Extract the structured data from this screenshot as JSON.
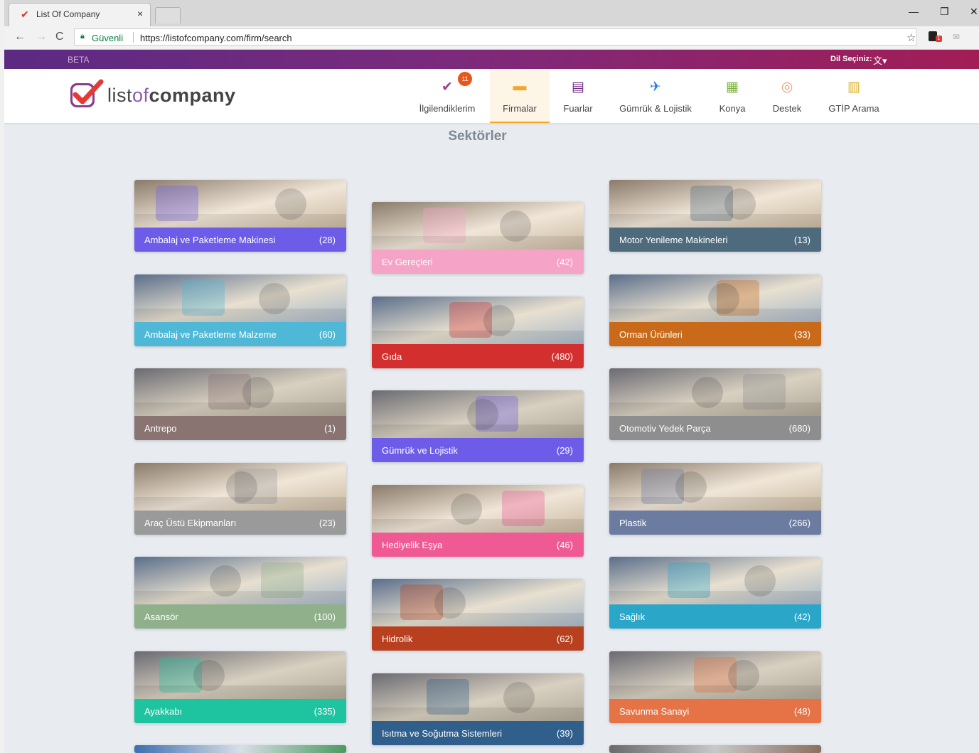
{
  "browser": {
    "tab_title": "List Of Company",
    "tab_close": "×",
    "secure_label": "Güvenli",
    "url": "https://listofcompany.com/firm/search",
    "window_minimize": "—",
    "window_restore": "❐",
    "window_close": "✕"
  },
  "site": {
    "beta": "BETA",
    "language_label": "Dil Seçiniz:",
    "logo_text_list": "list",
    "logo_text_of": "of",
    "logo_text_company": "company",
    "nav": [
      {
        "label": "İlgilendiklerim",
        "icon": "heart-check-icon",
        "badge": "11",
        "color": "#9b3a8e"
      },
      {
        "label": "Firmalar",
        "icon": "briefcase-icon",
        "color": "#f5a623",
        "active": true
      },
      {
        "label": "Fuarlar",
        "icon": "calendar-icon",
        "color": "#6b2a80"
      },
      {
        "label": "Gümrük & Lojistik",
        "icon": "plane-landing-icon",
        "color": "#2f7fd6"
      },
      {
        "label": "Konya",
        "icon": "building-icon",
        "color": "#7cb342"
      },
      {
        "label": "Destek",
        "icon": "support-icon",
        "color": "#e8a080"
      },
      {
        "label": "GTİP Arama",
        "icon": "barcode-scan-icon",
        "color": "#e0b020"
      }
    ]
  },
  "main": {
    "title": "Sektörler",
    "sectors": [
      {
        "name": "Ambalaj ve Paketleme Makinesi",
        "count": "(28)",
        "color": "#6d5ce8",
        "col": 0
      },
      {
        "name": "Ambalaj ve Paketleme Malzeme",
        "count": "(60)",
        "color": "#4fb8d6",
        "col": 0
      },
      {
        "name": "Antrepo",
        "count": "(1)",
        "color": "#8a7472",
        "col": 0
      },
      {
        "name": "Araç Üstü Ekipmanları",
        "count": "(23)",
        "color": "#9a9a9a",
        "col": 0
      },
      {
        "name": "Asansör",
        "count": "(100)",
        "color": "#8fb08a",
        "col": 0
      },
      {
        "name": "Ayakkabı",
        "count": "(335)",
        "color": "#1ec4a0",
        "col": 0
      },
      {
        "name": "Ev Gereçleri",
        "count": "(42)",
        "color": "#f5a3c7",
        "col": 1
      },
      {
        "name": "Gıda",
        "count": "(480)",
        "color": "#d32f2f",
        "col": 1
      },
      {
        "name": "Gümrük ve Lojistik",
        "count": "(29)",
        "color": "#6d5ce8",
        "col": 1
      },
      {
        "name": "Hediyelik Eşya",
        "count": "(46)",
        "color": "#ef5a95",
        "col": 1
      },
      {
        "name": "Hidrolik",
        "count": "(62)",
        "color": "#b8401e",
        "col": 1
      },
      {
        "name": "Isıtma ve Soğutma Sistemleri",
        "count": "(39)",
        "color": "#2f5f8a",
        "col": 1
      },
      {
        "name": "Motor Yenileme Makineleri",
        "count": "(13)",
        "color": "#4e6b7d",
        "col": 2
      },
      {
        "name": "Orman Ürünleri",
        "count": "(33)",
        "color": "#c96a1a",
        "col": 2
      },
      {
        "name": "Otomotiv Yedek Parça",
        "count": "(680)",
        "color": "#8e8e8e",
        "col": 2
      },
      {
        "name": "Plastik",
        "count": "(266)",
        "color": "#6c7ba0",
        "col": 2
      },
      {
        "name": "Sağlık",
        "count": "(42)",
        "color": "#2aa6c9",
        "col": 2
      },
      {
        "name": "Savunma Sanayi",
        "count": "(48)",
        "color": "#e57345",
        "col": 2
      }
    ]
  }
}
